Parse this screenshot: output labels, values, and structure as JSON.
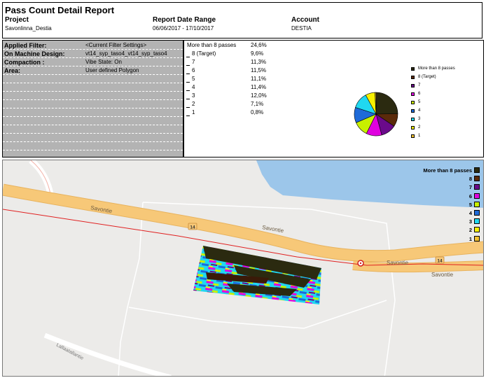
{
  "report": {
    "title": "Pass Count Detail Report",
    "project_label": "Project",
    "project_value": "Savonlinna_Destia",
    "date_label": "Report Date Range",
    "date_value": "06/06/2017 - 17/10/2017",
    "account_label": "Account",
    "account_value": "DESTIA"
  },
  "filters": [
    {
      "label": "Applied Filter:",
      "value": "<Current Filter Settings>"
    },
    {
      "label": "On Machine Design:",
      "value": "vt14_syp_taso4_vt14_syp_taso4"
    },
    {
      "label": "Compaction :",
      "value": "Vibe State: On"
    },
    {
      "label": "Area:",
      "value": "User defined Polygon"
    }
  ],
  "stats": [
    {
      "label": "More than 8 passes",
      "value": "24,6%"
    },
    {
      "label": "8 (Target)",
      "value": "9,6%"
    },
    {
      "label": "7",
      "value": "11,3%"
    },
    {
      "label": "6",
      "value": "11,5%"
    },
    {
      "label": "5",
      "value": "11,1%"
    },
    {
      "label": "4",
      "value": "11,4%"
    },
    {
      "label": "3",
      "value": "12,0%"
    },
    {
      "label": "2",
      "value": "7,1%"
    },
    {
      "label": "1",
      "value": "0,8%"
    }
  ],
  "chart_data": {
    "type": "pie",
    "title": "",
    "legend_position": "right",
    "categories": [
      "More than 8 passes",
      "8 (Target)",
      "7",
      "6",
      "5",
      "4",
      "3",
      "2",
      "1"
    ],
    "values": [
      24.6,
      9.6,
      11.3,
      11.5,
      11.1,
      11.4,
      12.0,
      7.1,
      0.8
    ],
    "colors": [
      "#2b2a10",
      "#5a2a0a",
      "#6a0a8a",
      "#e000e0",
      "#c8f000",
      "#1e6ad8",
      "#20d8f0",
      "#f8f000",
      "#f0c030"
    ]
  },
  "map": {
    "road_labels": [
      "Savontie",
      "Savontie",
      "Savontie",
      "Savontie",
      "Lallaatallantie"
    ],
    "road_number": "14",
    "legend": [
      {
        "label": "More than 8 passes",
        "color": "#2b2a10"
      },
      {
        "label": "8",
        "color": "#5a2a0a"
      },
      {
        "label": "7",
        "color": "#6a0a8a"
      },
      {
        "label": "6",
        "color": "#e000e0"
      },
      {
        "label": "5",
        "color": "#c8f000"
      },
      {
        "label": "4",
        "color": "#1e6ad8"
      },
      {
        "label": "3",
        "color": "#20d8f0"
      },
      {
        "label": "2",
        "color": "#f8f000"
      },
      {
        "label": "1",
        "color": "#f0c030"
      }
    ],
    "colors": {
      "land": "#ecebe9",
      "water": "#9cc6ea",
      "road": "#f7c878",
      "route_line": "#e02020"
    }
  }
}
